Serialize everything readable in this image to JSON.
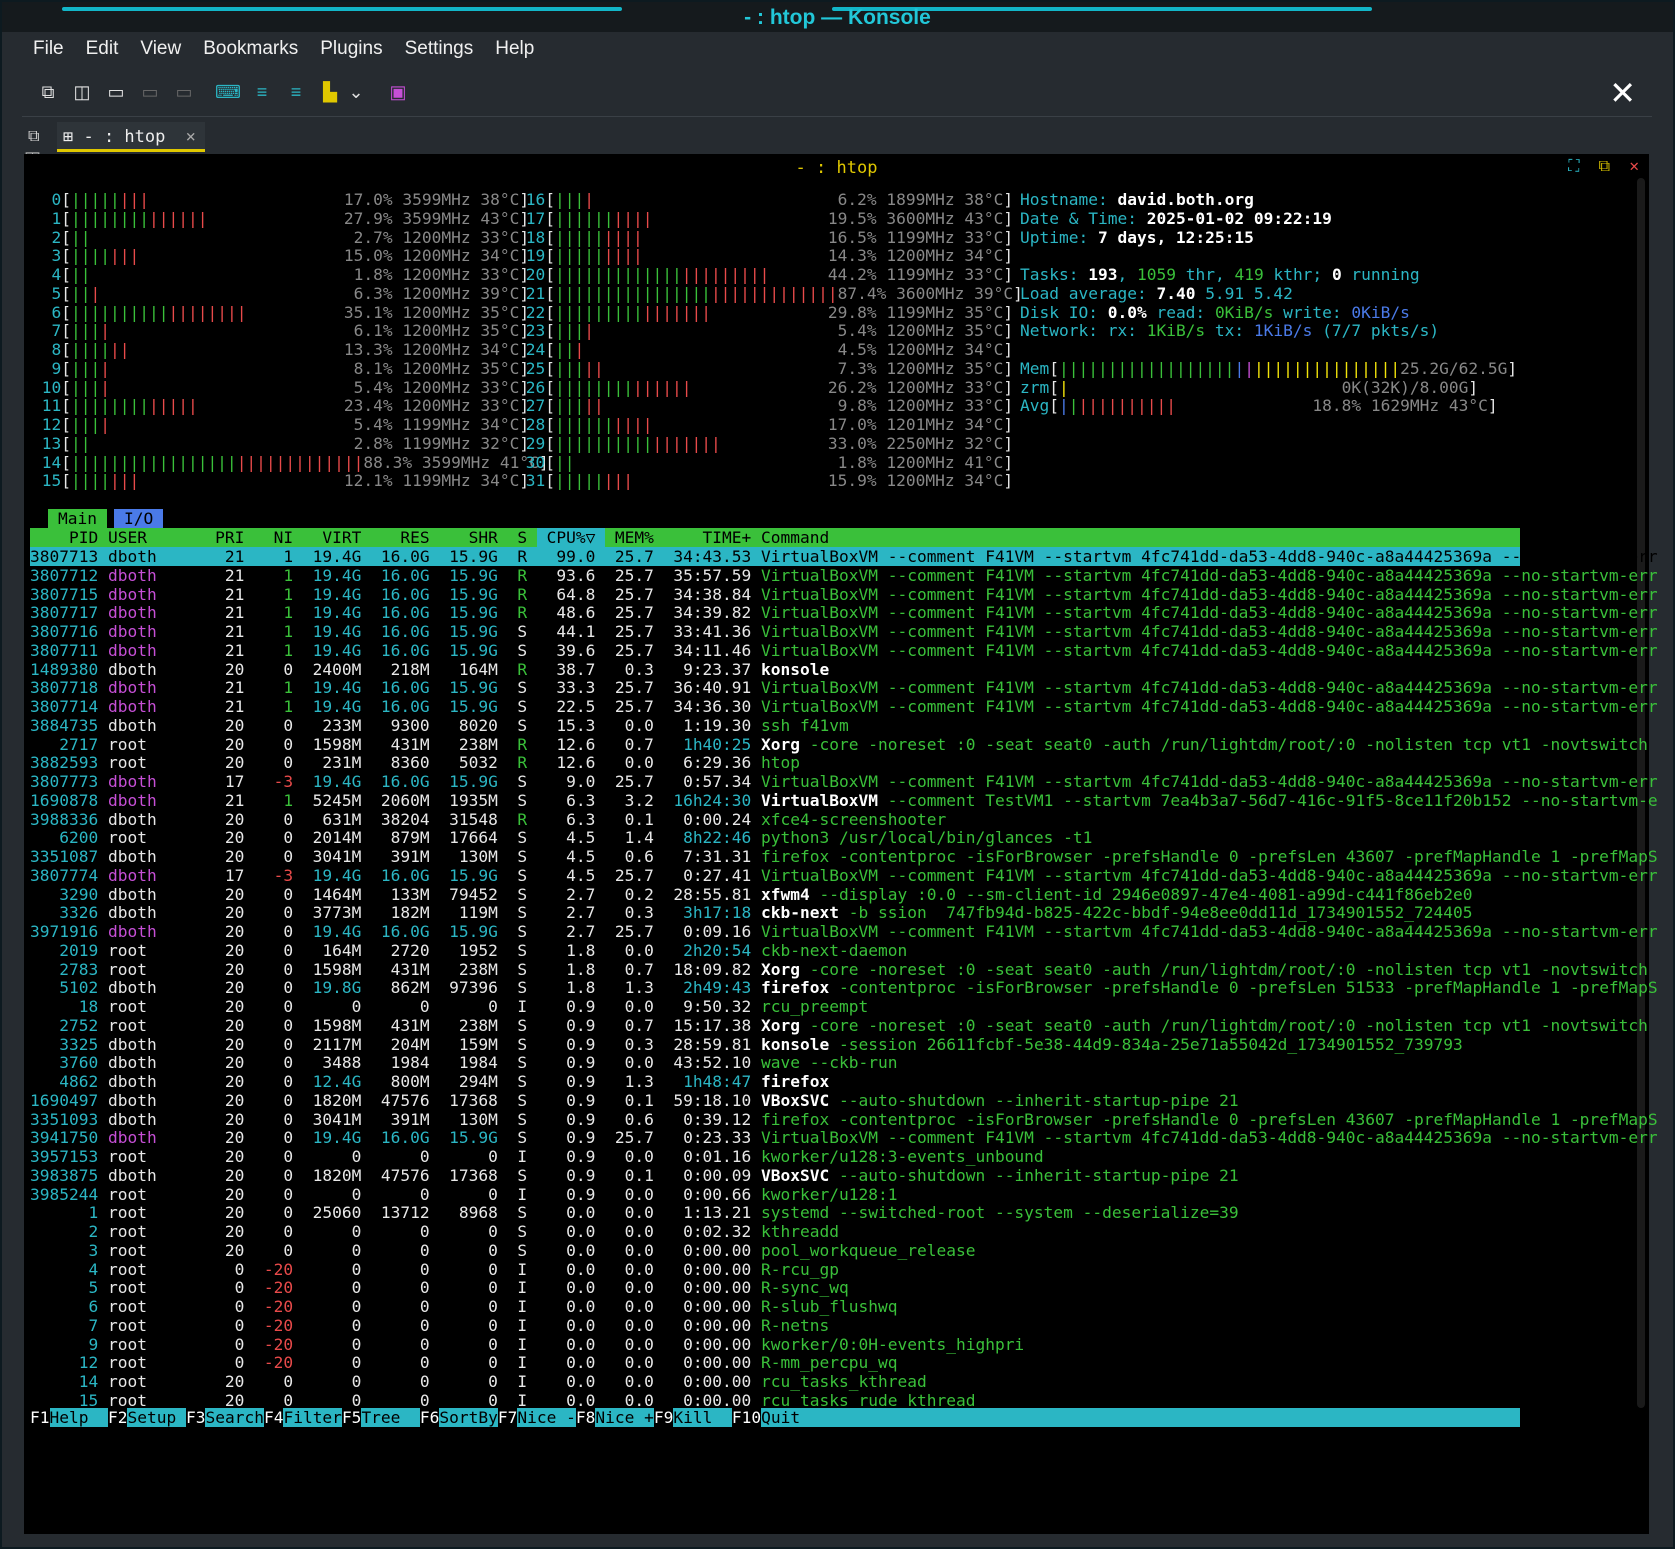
{
  "window": {
    "title": "- : htop — Konsole"
  },
  "menubar": {
    "items": [
      "File",
      "Edit",
      "View",
      "Bookmarks",
      "Plugins",
      "Settings",
      "Help"
    ]
  },
  "tab": {
    "label": "- : htop",
    "close": "×"
  },
  "pane": {
    "title": "- : htop"
  },
  "cpus_left": [
    [
      "0",
      "|||||||| ",
      "17.0%",
      "3599MHz",
      "38°C"
    ],
    [
      "1",
      "|||||||||||||| ",
      "27.9%",
      "3599MHz",
      "43°C"
    ],
    [
      "2",
      "|| ",
      "2.7%",
      "1200MHz",
      "33°C"
    ],
    [
      "3",
      "||||||| ",
      "15.0%",
      "1200MHz",
      "34°C"
    ],
    [
      "4",
      "|| ",
      "1.8%",
      "1200MHz",
      "33°C"
    ],
    [
      "5",
      "||| ",
      "6.3%",
      "1200MHz",
      "39°C"
    ],
    [
      "6",
      "|||||||||||||||||| ",
      "35.1%",
      "1200MHz",
      "35°C"
    ],
    [
      "7",
      "|||| ",
      "6.1%",
      "1200MHz",
      "35°C"
    ],
    [
      "8",
      "|||||| ",
      "13.3%",
      "1200MHz",
      "34°C"
    ],
    [
      "9",
      "|||| ",
      "8.1%",
      "1200MHz",
      "35°C"
    ],
    [
      "10",
      "|||| ",
      "5.4%",
      "1200MHz",
      "33°C"
    ],
    [
      "11",
      "||||||||||||| ",
      "23.4%",
      "1200MHz",
      "33°C"
    ],
    [
      "12",
      "|||| ",
      "5.4%",
      "1199MHz",
      "34°C"
    ],
    [
      "13",
      "|| ",
      "2.8%",
      "1199MHz",
      "32°C"
    ],
    [
      "14",
      "||||||||||||||||||||||||||||||",
      "88.3%",
      "3599MHz",
      "41°C"
    ],
    [
      "15",
      "||||||| ",
      "12.1%",
      "1199MHz",
      "34°C"
    ]
  ],
  "cpus_right": [
    [
      "16",
      "|||| ",
      "6.2%",
      "1899MHz",
      "38°C"
    ],
    [
      "17",
      "|||||||||| ",
      "19.5%",
      "3600MHz",
      "43°C"
    ],
    [
      "18",
      "||||||||| ",
      "16.5%",
      "1199MHz",
      "33°C"
    ],
    [
      "19",
      "||||||||| ",
      "14.3%",
      "1200MHz",
      "34°C"
    ],
    [
      "20",
      "|||||||||||||||||||||| ",
      "44.2%",
      "1199MHz",
      "33°C"
    ],
    [
      "21",
      "|||||||||||||||||||||||||||||",
      "87.4%",
      "3600MHz",
      "39°C"
    ],
    [
      "22",
      "|||||||||||||||| ",
      "29.8%",
      "1199MHz",
      "35°C"
    ],
    [
      "23",
      "|||| ",
      "5.4%",
      "1200MHz",
      "35°C"
    ],
    [
      "24",
      "||| ",
      "4.5%",
      "1200MHz",
      "34°C"
    ],
    [
      "25",
      "||||| ",
      "7.3%",
      "1200MHz",
      "35°C"
    ],
    [
      "26",
      "|||||||||||||| ",
      "26.2%",
      "1200MHz",
      "33°C"
    ],
    [
      "27",
      "||||| ",
      "9.8%",
      "1200MHz",
      "33°C"
    ],
    [
      "28",
      "|||||||||| ",
      "17.0%",
      "1201MHz",
      "34°C"
    ],
    [
      "29",
      "||||||||||||||||| ",
      "33.0%",
      "2250MHz",
      "32°C"
    ],
    [
      "30",
      "|| ",
      "1.8%",
      "1200MHz",
      "41°C"
    ],
    [
      "31",
      "|||||||| ",
      "15.9%",
      "1200MHz",
      "34°C"
    ]
  ],
  "info": {
    "hostname_label": "Hostname: ",
    "hostname": "david.both.org",
    "datetime_label": "Date & Time: ",
    "datetime": "2025-01-02 09:22:19",
    "uptime_label": "Uptime: ",
    "uptime": "7 days, 12:25:15",
    "tasks": "Tasks: ",
    "tasks_n": "193",
    "thr": "1059",
    "kthr": "419",
    "running": "0",
    "load_label": "Load average: ",
    "load1": "7.40",
    "load5": "5.91",
    "load15": "5.42",
    "disk": "Disk IO: ",
    "disk_pct": "0.0%",
    "disk_read": "0KiB/s",
    "disk_write": "0KiB/s",
    "net": "Network: rx: ",
    "net_rx": "1KiB/s",
    "net_tx": "1KiB/s",
    "net_pkts": "(7/7 pkts/s)",
    "mem": "25.2G/62.5G",
    "zrm": "0K(32K)/8.00G",
    "avg": "18.8% 1629MHz 43°C"
  },
  "tabs": {
    "main": "Main",
    "io": "I/O"
  },
  "header": [
    "PID",
    "USER",
    "PRI",
    "NI",
    "VIRT",
    "RES",
    "SHR",
    "S",
    "CPU%▽",
    "MEM%",
    "TIME+",
    "Command"
  ],
  "processes": [
    [
      "3807713",
      "dboth",
      "21",
      "1",
      "19.4G",
      "16.0G",
      "15.9G",
      "R",
      "99.0",
      "25.7",
      "34:43.53",
      "VirtualBoxVM --comment F41VM --startvm 4fc741dd-da53-4dd8-940c-a8a44425369a --no-startvm-err"
    ],
    [
      "3807712",
      "dboth",
      "21",
      "1",
      "19.4G",
      "16.0G",
      "15.9G",
      "R",
      "93.6",
      "25.7",
      "35:57.59",
      "VirtualBoxVM --comment F41VM --startvm 4fc741dd-da53-4dd8-940c-a8a44425369a --no-startvm-err"
    ],
    [
      "3807715",
      "dboth",
      "21",
      "1",
      "19.4G",
      "16.0G",
      "15.9G",
      "R",
      "64.8",
      "25.7",
      "34:38.84",
      "VirtualBoxVM --comment F41VM --startvm 4fc741dd-da53-4dd8-940c-a8a44425369a --no-startvm-err"
    ],
    [
      "3807717",
      "dboth",
      "21",
      "1",
      "19.4G",
      "16.0G",
      "15.9G",
      "R",
      "48.6",
      "25.7",
      "34:39.82",
      "VirtualBoxVM --comment F41VM --startvm 4fc741dd-da53-4dd8-940c-a8a44425369a --no-startvm-err"
    ],
    [
      "3807716",
      "dboth",
      "21",
      "1",
      "19.4G",
      "16.0G",
      "15.9G",
      "S",
      "44.1",
      "25.7",
      "33:41.36",
      "VirtualBoxVM --comment F41VM --startvm 4fc741dd-da53-4dd8-940c-a8a44425369a --no-startvm-err"
    ],
    [
      "3807711",
      "dboth",
      "21",
      "1",
      "19.4G",
      "16.0G",
      "15.9G",
      "S",
      "39.6",
      "25.7",
      "34:11.46",
      "VirtualBoxVM --comment F41VM --startvm 4fc741dd-da53-4dd8-940c-a8a44425369a --no-startvm-err"
    ],
    [
      "1489380",
      "dboth",
      "20",
      "0",
      "2400M",
      "218M",
      "164M",
      "R",
      "38.7",
      "0.3",
      "9:23.37",
      "konsole"
    ],
    [
      "3807718",
      "dboth",
      "21",
      "1",
      "19.4G",
      "16.0G",
      "15.9G",
      "S",
      "33.3",
      "25.7",
      "36:40.91",
      "VirtualBoxVM --comment F41VM --startvm 4fc741dd-da53-4dd8-940c-a8a44425369a --no-startvm-err"
    ],
    [
      "3807714",
      "dboth",
      "21",
      "1",
      "19.4G",
      "16.0G",
      "15.9G",
      "S",
      "22.5",
      "25.7",
      "34:36.30",
      "VirtualBoxVM --comment F41VM --startvm 4fc741dd-da53-4dd8-940c-a8a44425369a --no-startvm-err"
    ],
    [
      "3884735",
      "dboth",
      "20",
      "0",
      "233M",
      "9300",
      "8020",
      "S",
      "15.3",
      "0.0",
      "1:19.30",
      "ssh f41vm"
    ],
    [
      "2717",
      "root",
      "20",
      "0",
      "1598M",
      "431M",
      "238M",
      "R",
      "12.6",
      "0.7",
      "1h40:25",
      "Xorg -core -noreset :0 -seat seat0 -auth /run/lightdm/root/:0 -nolisten tcp vt1 -novtswitch"
    ],
    [
      "3882593",
      "root",
      "20",
      "0",
      "231M",
      "8360",
      "5032",
      "R",
      "12.6",
      "0.0",
      "6:29.36",
      "htop"
    ],
    [
      "3807773",
      "dboth",
      "17",
      "-3",
      "19.4G",
      "16.0G",
      "15.9G",
      "S",
      "9.0",
      "25.7",
      "0:57.34",
      "VirtualBoxVM --comment F41VM --startvm 4fc741dd-da53-4dd8-940c-a8a44425369a --no-startvm-err"
    ],
    [
      "1690878",
      "dboth",
      "21",
      "1",
      "5245M",
      "2060M",
      "1935M",
      "S",
      "6.3",
      "3.2",
      "16h24:30",
      "VirtualBoxVM --comment TestVM1 --startvm 7ea4b3a7-56d7-416c-91f5-8ce11f20b152 --no-startvm-e"
    ],
    [
      "3988336",
      "dboth",
      "20",
      "0",
      "631M",
      "38204",
      "31548",
      "R",
      "6.3",
      "0.1",
      "0:00.24",
      "xfce4-screenshooter"
    ],
    [
      "6200",
      "root",
      "20",
      "0",
      "2014M",
      "879M",
      "17664",
      "S",
      "4.5",
      "1.4",
      "8h22:46",
      "python3 /usr/local/bin/glances -t1"
    ],
    [
      "3351087",
      "dboth",
      "20",
      "0",
      "3041M",
      "391M",
      "130M",
      "S",
      "4.5",
      "0.6",
      "7:31.31",
      "firefox -contentproc -isForBrowser -prefsHandle 0 -prefsLen 43607 -prefMapHandle 1 -prefMapS"
    ],
    [
      "3807774",
      "dboth",
      "17",
      "-3",
      "19.4G",
      "16.0G",
      "15.9G",
      "S",
      "4.5",
      "25.7",
      "0:27.41",
      "VirtualBoxVM --comment F41VM --startvm 4fc741dd-da53-4dd8-940c-a8a44425369a --no-startvm-err"
    ],
    [
      "3290",
      "dboth",
      "20",
      "0",
      "1464M",
      "133M",
      "79452",
      "S",
      "2.7",
      "0.2",
      "28:55.81",
      "xfwm4 --display :0.0 --sm-client-id 2946e0897-47e4-4081-a99d-c441f86eb2e0"
    ],
    [
      "3326",
      "dboth",
      "20",
      "0",
      "3773M",
      "182M",
      "119M",
      "S",
      "2.7",
      "0.3",
      "3h17:18",
      "ckb-next -b ssion  747fb94d-b825-422c-bbdf-94e8ee0dd11d_1734901552_724405"
    ],
    [
      "3971916",
      "dboth",
      "20",
      "0",
      "19.4G",
      "16.0G",
      "15.9G",
      "S",
      "2.7",
      "25.7",
      "0:09.16",
      "VirtualBoxVM --comment F41VM --startvm 4fc741dd-da53-4dd8-940c-a8a44425369a --no-startvm-err"
    ],
    [
      "2019",
      "root",
      "20",
      "0",
      "164M",
      "2720",
      "1952",
      "S",
      "1.8",
      "0.0",
      "2h20:54",
      "ckb-next-daemon"
    ],
    [
      "2783",
      "root",
      "20",
      "0",
      "1598M",
      "431M",
      "238M",
      "S",
      "1.8",
      "0.7",
      "18:09.82",
      "Xorg -core -noreset :0 -seat seat0 -auth /run/lightdm/root/:0 -nolisten tcp vt1 -novtswitch"
    ],
    [
      "5102",
      "dboth",
      "20",
      "0",
      "19.8G",
      "862M",
      "97396",
      "S",
      "1.8",
      "1.3",
      "2h49:43",
      "firefox -contentproc -isForBrowser -prefsHandle 0 -prefsLen 51533 -prefMapHandle 1 -prefMapS"
    ],
    [
      "18",
      "root",
      "20",
      "0",
      "0",
      "0",
      "0",
      "I",
      "0.9",
      "0.0",
      "9:50.32",
      "rcu_preempt"
    ],
    [
      "2752",
      "root",
      "20",
      "0",
      "1598M",
      "431M",
      "238M",
      "S",
      "0.9",
      "0.7",
      "15:17.38",
      "Xorg -core -noreset :0 -seat seat0 -auth /run/lightdm/root/:0 -nolisten tcp vt1 -novtswitch"
    ],
    [
      "3325",
      "dboth",
      "20",
      "0",
      "2117M",
      "204M",
      "159M",
      "S",
      "0.9",
      "0.3",
      "28:59.81",
      "konsole -session 26611fcbf-5e38-44d9-834a-25e71a55042d_1734901552_739793"
    ],
    [
      "3760",
      "dboth",
      "20",
      "0",
      "3488",
      "1984",
      "1984",
      "S",
      "0.9",
      "0.0",
      "43:52.10",
      "wave --ckb-run"
    ],
    [
      "4862",
      "dboth",
      "20",
      "0",
      "12.4G",
      "800M",
      "294M",
      "S",
      "0.9",
      "1.3",
      "1h48:47",
      "firefox"
    ],
    [
      "1690497",
      "dboth",
      "20",
      "0",
      "1820M",
      "47576",
      "17368",
      "S",
      "0.9",
      "0.1",
      "59:18.10",
      "VBoxSVC --auto-shutdown --inherit-startup-pipe 21"
    ],
    [
      "3351093",
      "dboth",
      "20",
      "0",
      "3041M",
      "391M",
      "130M",
      "S",
      "0.9",
      "0.6",
      "0:39.12",
      "firefox -contentproc -isForBrowser -prefsHandle 0 -prefsLen 43607 -prefMapHandle 1 -prefMapS"
    ],
    [
      "3941750",
      "dboth",
      "20",
      "0",
      "19.4G",
      "16.0G",
      "15.9G",
      "S",
      "0.9",
      "25.7",
      "0:23.33",
      "VirtualBoxVM --comment F41VM --startvm 4fc741dd-da53-4dd8-940c-a8a44425369a --no-startvm-err"
    ],
    [
      "3957153",
      "root",
      "20",
      "0",
      "0",
      "0",
      "0",
      "I",
      "0.9",
      "0.0",
      "0:01.16",
      "kworker/u128:3-events_unbound"
    ],
    [
      "3983875",
      "dboth",
      "20",
      "0",
      "1820M",
      "47576",
      "17368",
      "S",
      "0.9",
      "0.1",
      "0:00.09",
      "VBoxSVC --auto-shutdown --inherit-startup-pipe 21"
    ],
    [
      "3985244",
      "root",
      "20",
      "0",
      "0",
      "0",
      "0",
      "I",
      "0.9",
      "0.0",
      "0:00.66",
      "kworker/u128:1"
    ],
    [
      "1",
      "root",
      "20",
      "0",
      "25060",
      "13712",
      "8968",
      "S",
      "0.0",
      "0.0",
      "1:13.21",
      "systemd --switched-root --system --deserialize=39"
    ],
    [
      "2",
      "root",
      "20",
      "0",
      "0",
      "0",
      "0",
      "S",
      "0.0",
      "0.0",
      "0:02.32",
      "kthreadd"
    ],
    [
      "3",
      "root",
      "20",
      "0",
      "0",
      "0",
      "0",
      "S",
      "0.0",
      "0.0",
      "0:00.00",
      "pool_workqueue_release"
    ],
    [
      "4",
      "root",
      "0",
      "-20",
      "0",
      "0",
      "0",
      "I",
      "0.0",
      "0.0",
      "0:00.00",
      "R-rcu_gp"
    ],
    [
      "5",
      "root",
      "0",
      "-20",
      "0",
      "0",
      "0",
      "I",
      "0.0",
      "0.0",
      "0:00.00",
      "R-sync_wq"
    ],
    [
      "6",
      "root",
      "0",
      "-20",
      "0",
      "0",
      "0",
      "I",
      "0.0",
      "0.0",
      "0:00.00",
      "R-slub_flushwq"
    ],
    [
      "7",
      "root",
      "0",
      "-20",
      "0",
      "0",
      "0",
      "I",
      "0.0",
      "0.0",
      "0:00.00",
      "R-netns"
    ],
    [
      "9",
      "root",
      "0",
      "-20",
      "0",
      "0",
      "0",
      "I",
      "0.0",
      "0.0",
      "0:00.00",
      "kworker/0:0H-events_highpri"
    ],
    [
      "12",
      "root",
      "0",
      "-20",
      "0",
      "0",
      "0",
      "I",
      "0.0",
      "0.0",
      "0:00.00",
      "R-mm_percpu_wq"
    ],
    [
      "14",
      "root",
      "20",
      "0",
      "0",
      "0",
      "0",
      "I",
      "0.0",
      "0.0",
      "0:00.00",
      "rcu_tasks_kthread"
    ],
    [
      "15",
      "root",
      "20",
      "0",
      "0",
      "0",
      "0",
      "I",
      "0.0",
      "0.0",
      "0:00.00",
      "rcu_tasks_rude_kthread"
    ]
  ],
  "fkeys": [
    [
      "F1",
      "Help"
    ],
    [
      "F2",
      "Setup"
    ],
    [
      "F3",
      "Search"
    ],
    [
      "F4",
      "Filter"
    ],
    [
      "F5",
      "Tree"
    ],
    [
      "F6",
      "SortBy"
    ],
    [
      "F7",
      "Nice -"
    ],
    [
      "F8",
      "Nice +"
    ],
    [
      "F9",
      "Kill"
    ],
    [
      "F10",
      "Quit"
    ]
  ],
  "colors": {
    "cyan": "#2bb6c4",
    "green": "#3ac03a",
    "yellow": "#f2e30b",
    "magenta": "#c64fd6",
    "red": "#e84a4a",
    "blue": "#4a7ae8"
  }
}
